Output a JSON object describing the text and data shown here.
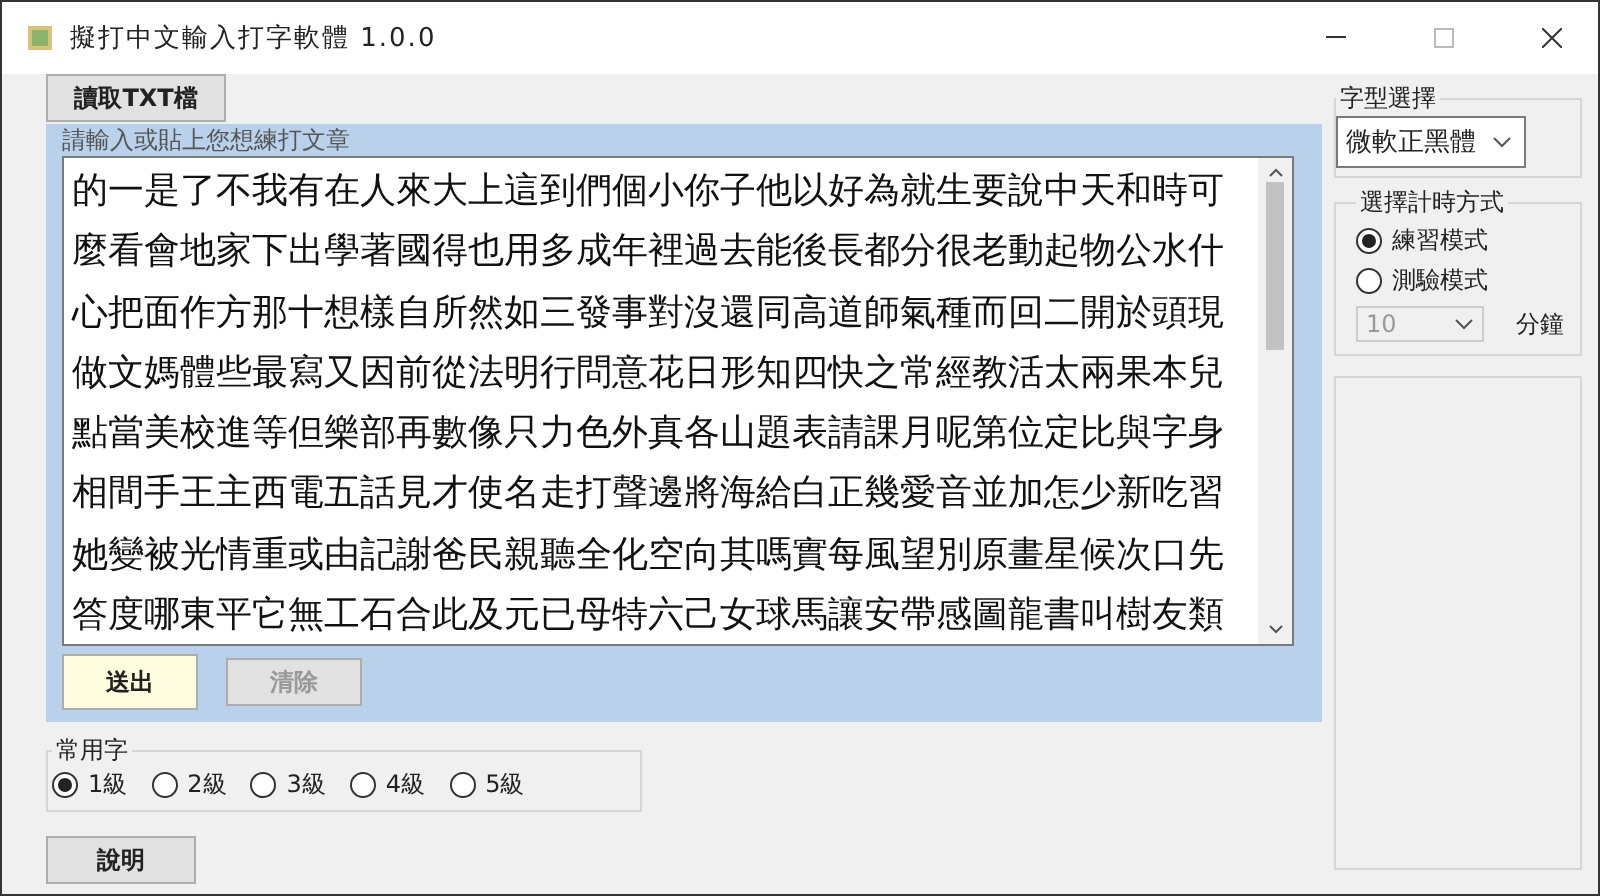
{
  "window": {
    "title": "擬打中文輸入打字軟體 1.0.0"
  },
  "load_button": "讀取TXT檔",
  "editor": {
    "label": "請輸入或貼上您想練打文章",
    "lines": [
      "的一是了不我有在人來大上這到們個小你子他以好為就生要說中天和時可",
      "麼看會地家下出學著國得也用多成年裡過去能後長都分很老動起物公水什",
      "心把面作方那十想樣自所然如三發事對沒還同高道師氣種而回二開於頭現",
      "做文媽體些最寫又因前從法明行問意花日形知四快之常經教活太兩果本兒",
      "點當美校進等但樂部再數像只力色外真各山題表請課月呢第位定比與字身",
      "相間手王主西電五話見才使名走打聲邊將海給白正幾愛音並加怎少新吃習",
      "她變被光情重或由記謝爸民親聽全化空向其嗎實每風望別原畫星候次口先",
      "答度哪東平它無工石合此及元已母特六己女球馬讓安帶感圖龍書叫樹友類"
    ]
  },
  "actions": [
    {
      "label": "送出",
      "disabled": false
    },
    {
      "label": "清除",
      "disabled": true
    }
  ],
  "levels": {
    "label": "常用字",
    "options": [
      {
        "label": "1級",
        "selected": true
      },
      {
        "label": "2級",
        "selected": false
      },
      {
        "label": "3級",
        "selected": false
      },
      {
        "label": "4級",
        "selected": false
      },
      {
        "label": "5級",
        "selected": false
      }
    ]
  },
  "help_button": "說明",
  "font": {
    "label": "字型選擇",
    "value": "微軟正黑體"
  },
  "timer": {
    "label": "選擇計時方式",
    "modes": [
      {
        "label": "練習模式",
        "selected": true
      },
      {
        "label": "測驗模式",
        "selected": false
      }
    ],
    "minutes": {
      "value": "10",
      "disabled": true
    },
    "unit": "分鐘"
  }
}
